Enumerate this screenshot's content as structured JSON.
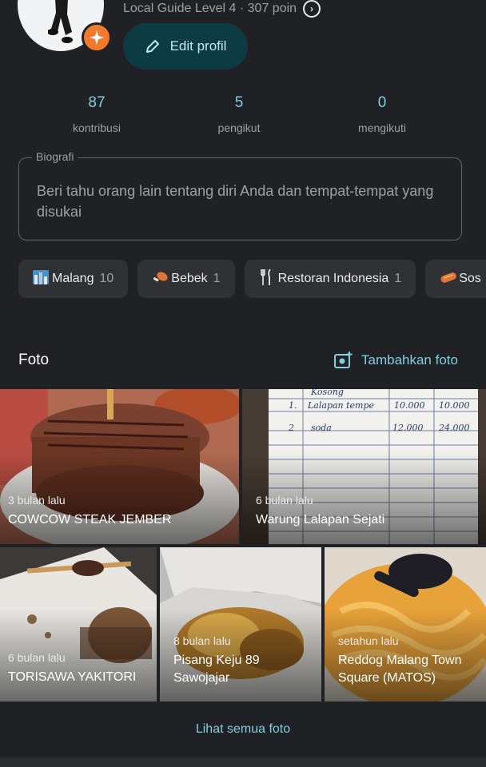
{
  "profile": {
    "level_text": "Local Guide Level 4 · 307 poin",
    "edit_label": "Edit profil"
  },
  "stats": [
    {
      "value": "87",
      "label": "kontribusi"
    },
    {
      "value": "5",
      "label": "pengikut"
    },
    {
      "value": "0",
      "label": "mengikuti"
    }
  ],
  "bio": {
    "label": "Biografi",
    "placeholder": "Beri tahu orang lain tentang diri Anda dan tempat-tempat yang disukai"
  },
  "chips": [
    {
      "label": "Malang",
      "count": "10",
      "icon": "city-icon"
    },
    {
      "label": "Bebek",
      "count": "1",
      "icon": "poultry-leg-icon"
    },
    {
      "label": "Restoran Indonesia",
      "count": "1",
      "icon": "fork-knife-icon"
    },
    {
      "label": "Sos",
      "count": "",
      "icon": "sausage-icon"
    }
  ],
  "photos_section": {
    "title": "Foto",
    "add_label": "Tambahkan foto",
    "see_all": "Lihat semua foto"
  },
  "photos": [
    {
      "time": "3 bulan lalu",
      "name": "COWCOW STEAK JEMBER"
    },
    {
      "time": "6 bulan lalu",
      "name": "Warung Lalapan Sejati"
    },
    {
      "time": "6 bulan lalu",
      "name": "TORISAWA YAKITORI"
    },
    {
      "time": "8 bulan lalu",
      "name": "Pisang Keju 89 Sawojajar"
    },
    {
      "time": "setahun lalu",
      "name": "Reddog Malang Town Square (MATOS)"
    }
  ],
  "receipt": {
    "header": "Kosong",
    "rows": [
      {
        "no": "1.",
        "item": "Lalapan tempe",
        "price": "10.000",
        "total": "10.000"
      },
      {
        "no": "2",
        "item": "soda",
        "price": "12.000",
        "total": "24.000"
      }
    ]
  },
  "colors": {
    "background": "#202124",
    "accent": "#7fcfe0",
    "badge": "#f27a2d",
    "edit_button": "#0d3b44"
  }
}
